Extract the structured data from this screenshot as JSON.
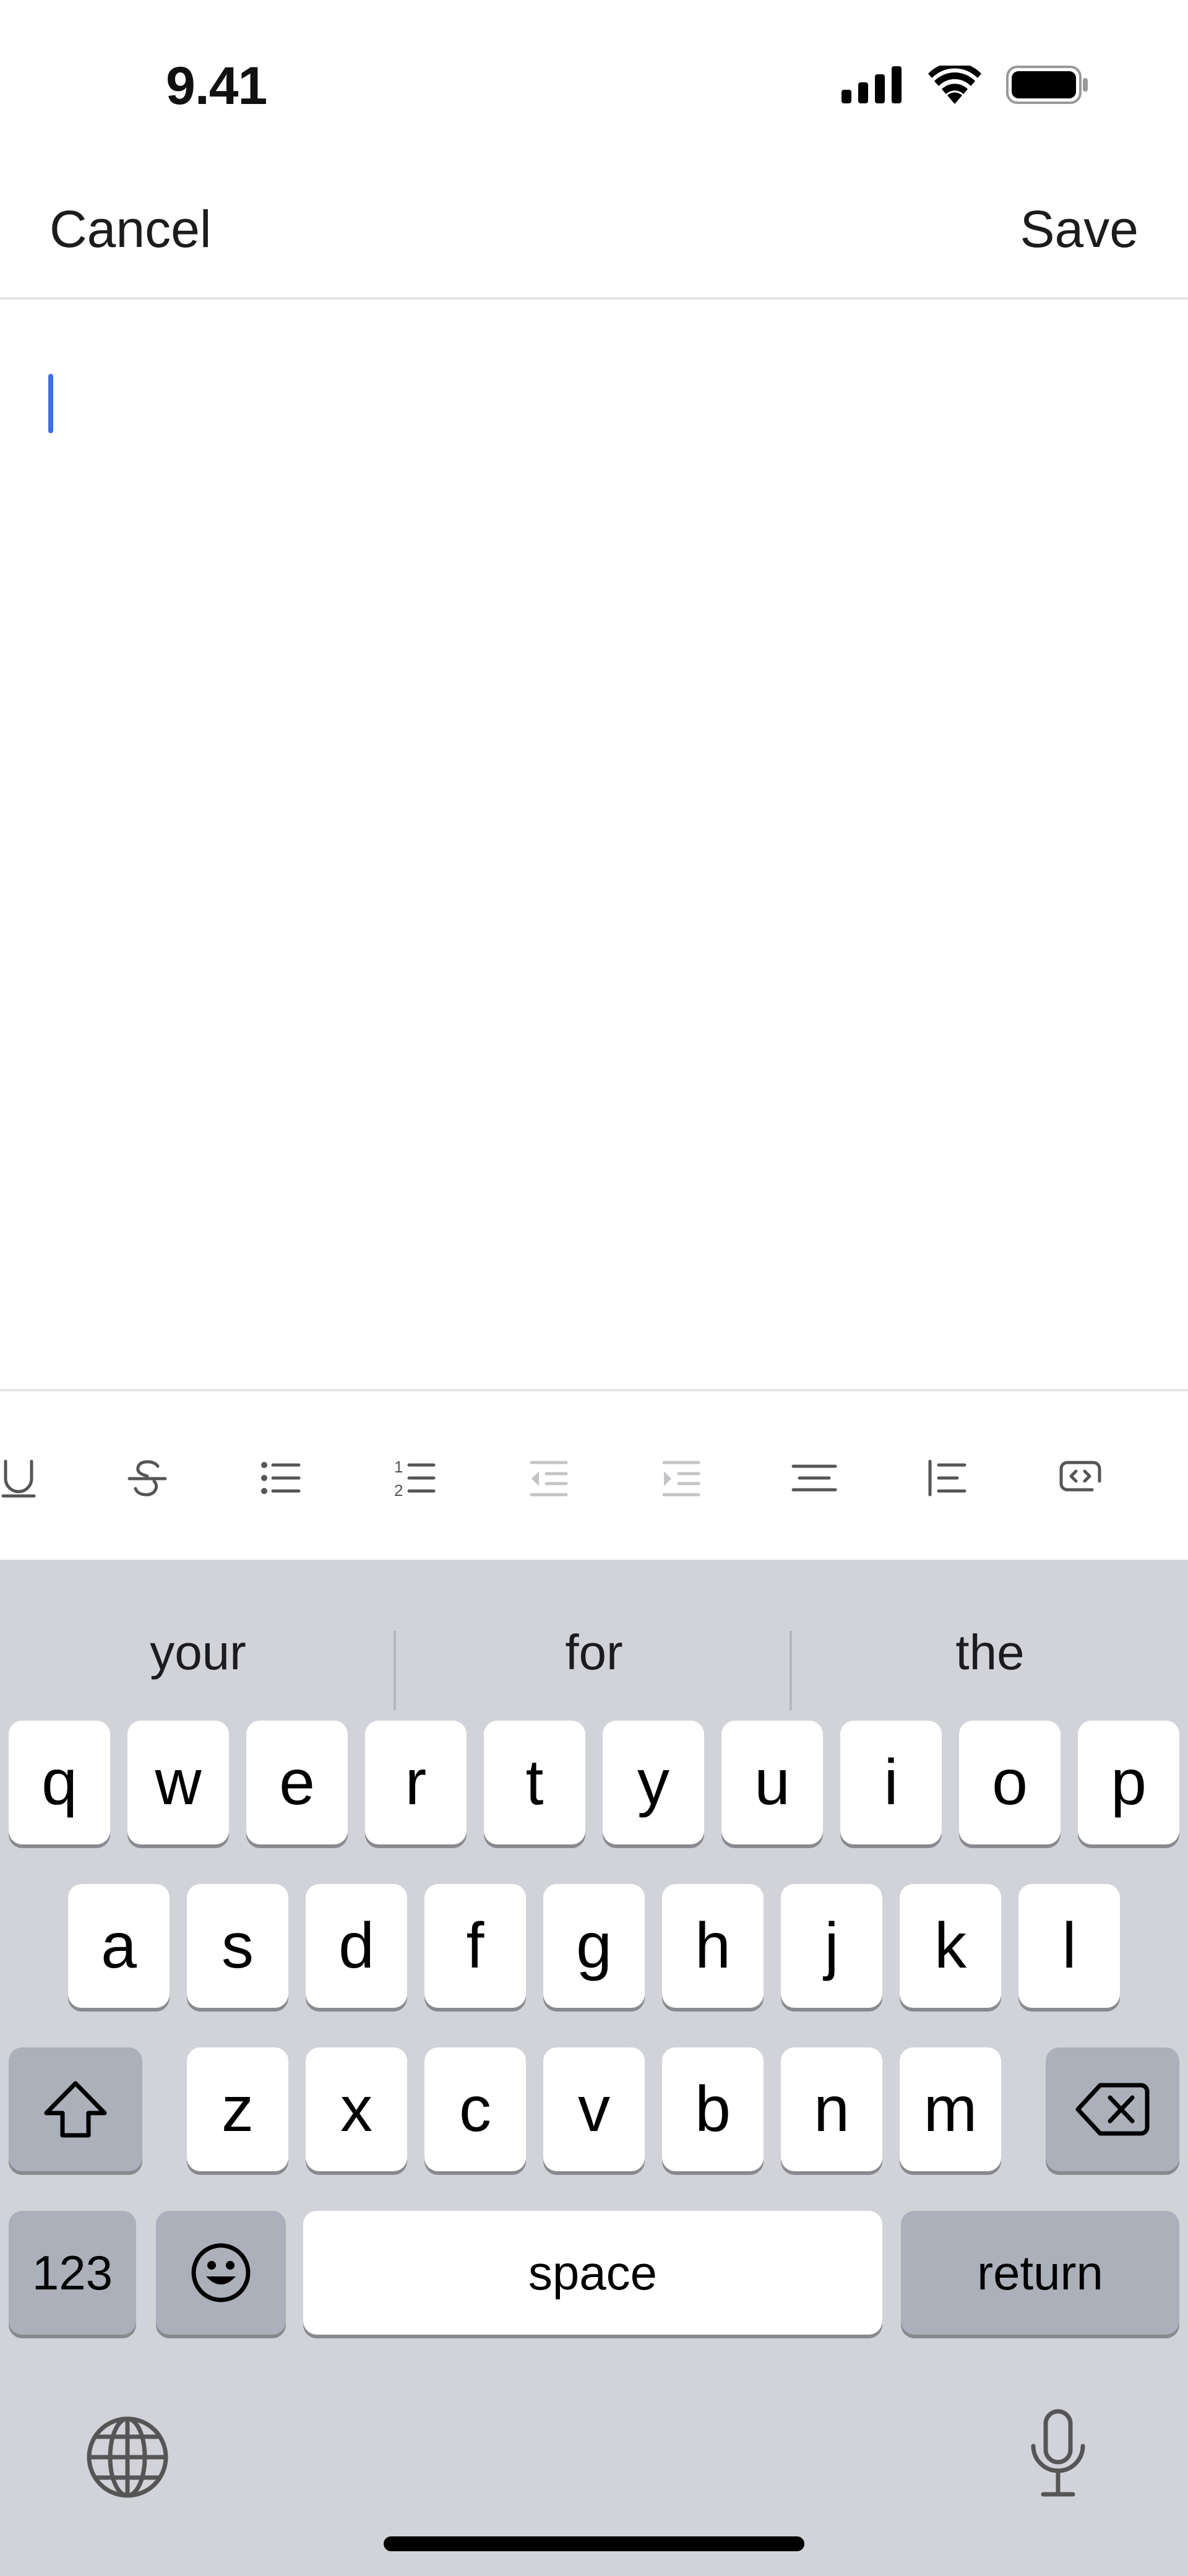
{
  "status_bar": {
    "time": "9.41",
    "icons": [
      "signal-icon",
      "wifi-icon",
      "battery-icon"
    ]
  },
  "nav": {
    "cancel_label": "Cancel",
    "save_label": "Save"
  },
  "editor": {
    "text": ""
  },
  "format_toolbar": {
    "items": [
      "underline-icon",
      "strikethrough-icon",
      "bullet-list-icon",
      "numbered-list-icon",
      "outdent-icon",
      "indent-icon",
      "align-center-icon",
      "blockquote-icon",
      "code-block-icon"
    ]
  },
  "keyboard": {
    "suggestions": [
      "your",
      "for",
      "the"
    ],
    "row1": [
      "q",
      "w",
      "e",
      "r",
      "t",
      "y",
      "u",
      "i",
      "o",
      "p"
    ],
    "row2": [
      "a",
      "s",
      "d",
      "f",
      "g",
      "h",
      "j",
      "k",
      "l"
    ],
    "row3": [
      "z",
      "x",
      "c",
      "v",
      "b",
      "n",
      "m"
    ],
    "numbers_label": "123",
    "space_label": "space",
    "return_label": "return"
  },
  "colors": {
    "cursor": "#3f6ee8",
    "keyboard_bg": "#d1d3d9",
    "key_dark": "#abb0ba"
  }
}
